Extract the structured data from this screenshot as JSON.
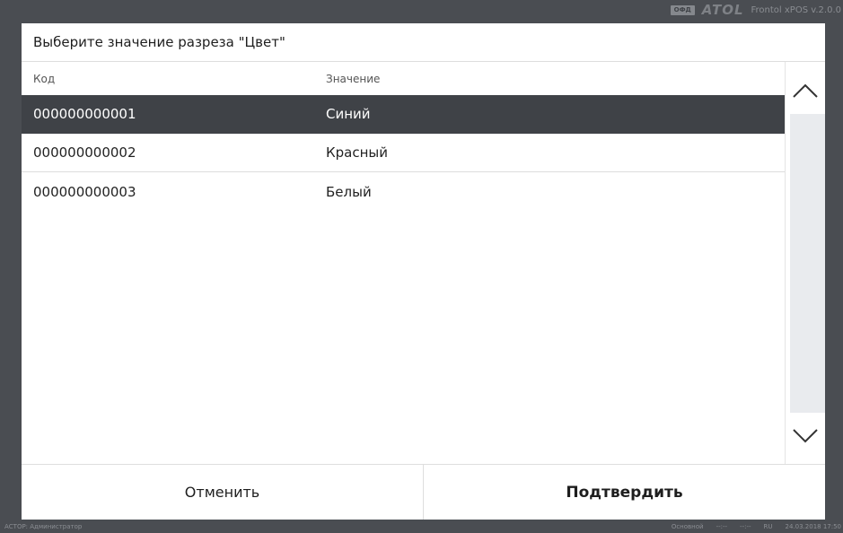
{
  "topbar": {
    "ofd_badge": "ОФД",
    "brand_logo": "ATOL",
    "app_version": "Frontol xPOS v.2.0.0"
  },
  "dialog": {
    "title": "Выберите значение разреза \"Цвет\"",
    "columns": {
      "code": "Код",
      "value": "Значение"
    },
    "rows": [
      {
        "code": "000000000001",
        "value": "Синий",
        "selected": true
      },
      {
        "code": "000000000002",
        "value": "Красный",
        "selected": false
      },
      {
        "code": "000000000003",
        "value": "Белый",
        "selected": false
      }
    ],
    "cancel_label": "Отменить",
    "confirm_label": "Подтвердить"
  },
  "statusbar": {
    "user": "АСТОР: Администратор",
    "mode": "Основной",
    "time1": "--:--",
    "time2": "--:--",
    "lang": "RU",
    "datetime": "24.03.2018 17:50"
  },
  "icons": {
    "scroll_up": "chevron-up-icon",
    "scroll_down": "chevron-down-icon"
  },
  "colors": {
    "background": "#4a4d52",
    "selected_row": "#3f4247",
    "scroll_track": "#e9ebee"
  }
}
